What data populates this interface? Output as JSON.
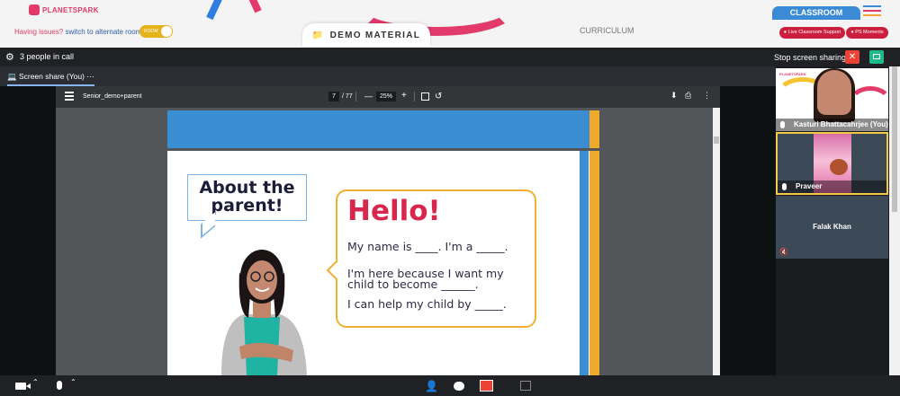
{
  "header": {
    "logo_text": "PLANETSPARK",
    "issues_text": "Having issues?",
    "switch_link": "switch to alternate room",
    "toggle_label": "ROOM",
    "demo_material": "DEMO MATERIAL",
    "curriculum": "CURRICULUM",
    "classroom": "CLASSROOM",
    "live_support": "Live Classroom Support",
    "ps_moments": "PS Moments"
  },
  "call": {
    "people_count": "3 people in call",
    "stop_sharing": "Stop screen sharing",
    "tab_label": "Screen share (You)",
    "tab_more": "⋯"
  },
  "pdf": {
    "filename": "Senior_demo+parent",
    "page": "7",
    "total": "/ 77",
    "zoom": "25%",
    "content": {
      "about_line1": "About the",
      "about_line2": "parent!",
      "hello": "Hello!",
      "line1": "My name is ____. I'm a _____.",
      "line2": "I'm here because I want my child to become ______.",
      "line3": "I can help my child by _____."
    }
  },
  "participants": [
    {
      "name": "Kasturi Bhattacahrjee (You)"
    },
    {
      "name": "Praveer"
    },
    {
      "name": "Falak Khan"
    }
  ],
  "colors": {
    "brand_pink": "#e23a6a",
    "classroom_blue": "#3a8ad6",
    "support_red": "#cc1f3d",
    "stop_red": "#ea4335",
    "pip_green": "#1db98a"
  }
}
